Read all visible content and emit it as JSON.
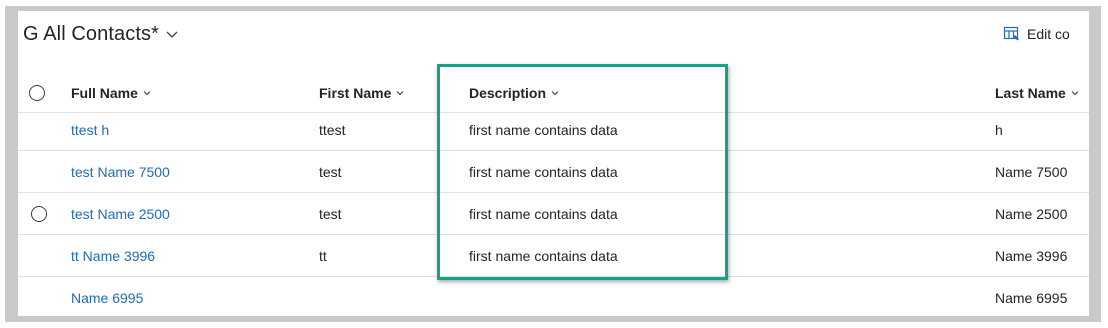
{
  "view": {
    "title": "G All Contacts*"
  },
  "toolbar": {
    "edit_columns_label": "Edit co"
  },
  "columns": [
    {
      "label": "Full Name"
    },
    {
      "label": "First Name"
    },
    {
      "label": "Description"
    },
    {
      "label": "Last Name"
    }
  ],
  "rows": [
    {
      "full_name": "ttest h",
      "first_name": "ttest",
      "description": "first name contains data",
      "last_name": "h"
    },
    {
      "full_name": "test Name 7500",
      "first_name": "test",
      "description": "first name contains data",
      "last_name": "Name 7500"
    },
    {
      "full_name": "test Name 2500",
      "first_name": "test",
      "description": "first name contains data",
      "last_name": "Name 2500"
    },
    {
      "full_name": "tt Name 3996",
      "first_name": "tt",
      "description": "first name contains data",
      "last_name": "Name 3996"
    },
    {
      "full_name": "Name 6995",
      "first_name": "",
      "description": "",
      "last_name": "Name 6995"
    }
  ],
  "colors": {
    "link": "#1f6bb8",
    "highlight": "#12a38a",
    "text": "#242424"
  }
}
